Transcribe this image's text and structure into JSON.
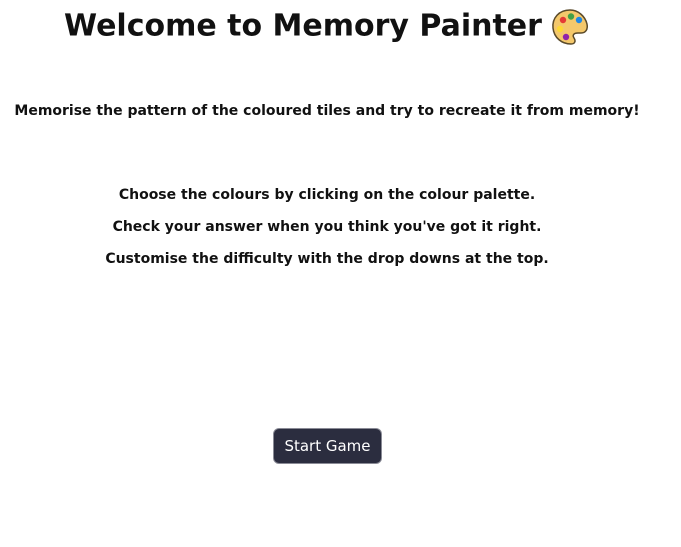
{
  "header": {
    "title": "Welcome to Memory Painter",
    "title_icon": "artist-palette-icon"
  },
  "main": {
    "intro": "Memorise the pattern of the coloured tiles and try to recreate it from memory!",
    "instructions": [
      "Choose the colours by clicking on the colour palette.",
      "Check your answer when you think you've got it right.",
      "Customise the difficulty with the drop downs at the top."
    ]
  },
  "actions": {
    "start_label": "Start Game"
  },
  "colors": {
    "button_background": "#2b2d3f",
    "button_text": "#ffffff",
    "palette_board": "#f4c86b",
    "palette_paints": [
      "#e53935",
      "#43a047",
      "#1e88e5",
      "#fdd835",
      "#8e24aa"
    ]
  }
}
